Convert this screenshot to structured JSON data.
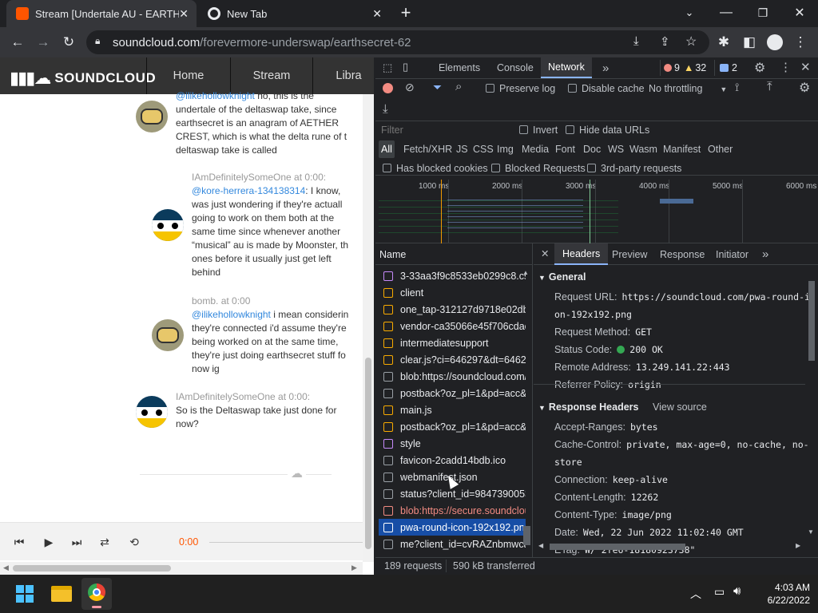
{
  "browser": {
    "tabs": [
      {
        "title": "Stream [Undertale AU - EARTHSE",
        "active": true
      },
      {
        "title": "New Tab",
        "active": false
      }
    ],
    "new_tab": "+",
    "url": {
      "host": "soundcloud.com",
      "path": "/forevermore-underswap/earthsecret-62"
    }
  },
  "page": {
    "logo": "SOUNDCLOUD",
    "nav": [
      "Home",
      "Stream",
      "Libra"
    ],
    "comments": [
      {
        "user": "",
        "time": "",
        "mention": "@ilikehollowknight",
        "lines": [
          " no, this is the",
          "undertale of the deltaswap take, since",
          "earthsecret is an anagram of AETHER",
          "CREST, which is what the delta rune of t",
          "deltaswap take is called"
        ]
      },
      {
        "user": "IAmDefinitelySomeOne",
        "at": " at ",
        "time": "0:00",
        "mention": "@kore-herrera-134138314",
        "lines": [
          ": I know,",
          "was just wondering if they're actuall",
          "going to work on them both at the",
          "same time since whenever another",
          "“musical” au is made by Moonster, th",
          "ones before it usually just get left",
          "behind"
        ]
      },
      {
        "user": "bomb.",
        "at": " at ",
        "time": "0:00",
        "mention": "@ilikehollowknight",
        "lines": [
          " i mean considerin",
          "they're connected i'd assume they're",
          "being worked on at the same time,",
          "they're just doing earthsecret stuff fo",
          "now ig"
        ]
      },
      {
        "user": "IAmDefinitelySomeOne",
        "at": " at ",
        "time": "0:00",
        "mention": "",
        "lines": [
          "So is the Deltaswap take just done for",
          "now?"
        ]
      }
    ],
    "player": {
      "time": "0:00"
    }
  },
  "devtools": {
    "tabs": [
      "Elements",
      "Console",
      "Network"
    ],
    "more": "»",
    "errors": "9",
    "warnings": "32",
    "messages": "2",
    "toolbar": {
      "preserve_log": "Preserve log",
      "disable_cache": "Disable cache",
      "throttling": "No throttling"
    },
    "filter": {
      "placeholder": "Filter",
      "invert": "Invert",
      "hide_data_urls": "Hide data URLs"
    },
    "types": [
      "All",
      "Fetch/XHR",
      "JS",
      "CSS",
      "Img",
      "Media",
      "Font",
      "Doc",
      "WS",
      "Wasm",
      "Manifest",
      "Other"
    ],
    "checks": [
      "Has blocked cookies",
      "Blocked Requests",
      "3rd-party requests"
    ],
    "timeline": [
      "1000 ms",
      "2000 ms",
      "3000 ms",
      "4000 ms",
      "5000 ms",
      "6000 ms"
    ],
    "name_header": "Name",
    "requests": [
      {
        "name": "3-33aa3f9c8533eb0299c8.css",
        "type": "css"
      },
      {
        "name": "client",
        "type": "js"
      },
      {
        "name": "one_tap-312127d9718e02dbc",
        "type": "js"
      },
      {
        "name": "vendor-ca35066e45f706cdae.",
        "type": "js"
      },
      {
        "name": "intermediatesupport",
        "type": "js"
      },
      {
        "name": "clear.js?ci=646297&dt=64629",
        "type": "js"
      },
      {
        "name": "blob:https://soundcloud.com/",
        "type": "doc"
      },
      {
        "name": "postback?oz_pl=1&pd=acc&",
        "type": "doc"
      },
      {
        "name": "main.js",
        "type": "js"
      },
      {
        "name": "postback?oz_pl=1&pd=acc&",
        "type": "js"
      },
      {
        "name": "style",
        "type": "css"
      },
      {
        "name": "favicon-2cadd14bdb.ico",
        "type": "doc"
      },
      {
        "name": "webmanifest.json",
        "type": "doc"
      },
      {
        "name": "status?client_id=9847390053.",
        "type": "doc"
      },
      {
        "name": "blob:https://secure.soundclou",
        "type": "err"
      },
      {
        "name": "pwa-round-icon-192x192.png",
        "type": "sel"
      },
      {
        "name": "me?client_id=cvRAZnbmwcaa",
        "type": "doc"
      }
    ],
    "detail_tabs": [
      "Headers",
      "Preview",
      "Response",
      "Initiator"
    ],
    "general_title": "General",
    "general": [
      {
        "k": "Request URL:",
        "v": "https://soundcloud.com/pwa-round-ic"
      },
      {
        "k": "",
        "v": "on-192x192.png"
      },
      {
        "k": "Request Method:",
        "v": "GET"
      },
      {
        "k": "Status Code:",
        "v": "200 OK"
      },
      {
        "k": "Remote Address:",
        "v": "13.249.141.22:443"
      },
      {
        "k": "Referrer Policy:",
        "v": "origin"
      }
    ],
    "response_title": "Response Headers",
    "view_source": "View source",
    "response": [
      {
        "k": "Accept-Ranges:",
        "v": "bytes"
      },
      {
        "k": "Cache-Control:",
        "v": "private, max-age=0, no-cache, no-"
      },
      {
        "k": "",
        "v": "store"
      },
      {
        "k": "Connection:",
        "v": "keep-alive"
      },
      {
        "k": "Content-Length:",
        "v": "12262"
      },
      {
        "k": "Content-Type:",
        "v": "image/png"
      },
      {
        "k": "Date:",
        "v": "Wed, 22 Jun 2022 11:02:40 GMT"
      },
      {
        "k": "ETag:",
        "v": "W/\"2fe6-18180923738\""
      }
    ],
    "status_requests": "189 requests",
    "status_transferred": "590 kB transferred"
  },
  "taskbar": {
    "time": "4:03 AM",
    "date": "6/22/2022"
  }
}
